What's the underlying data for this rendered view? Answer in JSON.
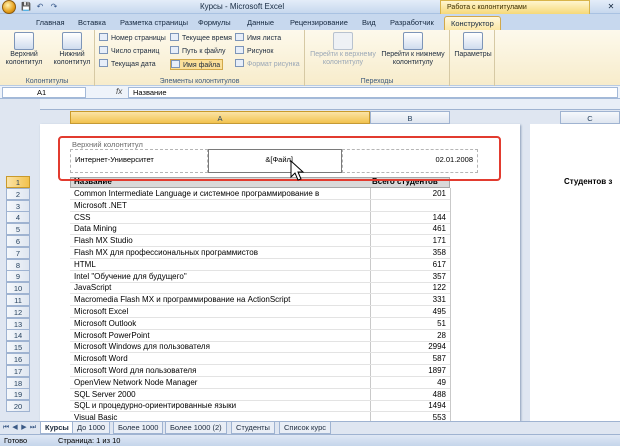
{
  "window": {
    "title": "Курсы - Microsoft Excel",
    "contextual": "Работа с колонтитулами"
  },
  "quick_access": {
    "save": "💾",
    "undo": "↶",
    "redo": "↷"
  },
  "window_controls": {
    "minimize": "–",
    "restore": "❐",
    "close": "✕"
  },
  "tabs": [
    "Главная",
    "Вставка",
    "Разметка страницы",
    "Формулы",
    "Данные",
    "Рецензирование",
    "Вид",
    "Разработчик",
    "Конструктор"
  ],
  "ribbon": {
    "groups": {
      "headers": "Колонтитулы",
      "elements": "Элементы колонтитулов",
      "nav": "Переходы",
      "params": ""
    },
    "buttons": {
      "header": "Верхний колонтитул",
      "footer": "Нижний колонтитул",
      "page_number": "Номер страницы",
      "page_count": "Число страниц",
      "current_date": "Текущая дата",
      "current_time": "Текущее время",
      "file_path": "Путь к файлу",
      "file_name": "Имя файла",
      "sheet_name": "Имя листа",
      "picture": "Рисунок",
      "format_picture": "Формат рисунка",
      "goto_header": "Перейти к верхнему колонтитулу",
      "goto_footer": "Перейти к нижнему колонтитулу",
      "params": "Параметры"
    }
  },
  "formula_bar": {
    "name_box": "A1",
    "fx": "fx",
    "value": "Название"
  },
  "columns": {
    "A": "A",
    "B": "B",
    "C": "C"
  },
  "header_zone": {
    "label": "Верхний колонтитул",
    "left": "Интернет-Университет",
    "center": "&[Файл]",
    "right": "02.01.2008"
  },
  "table": {
    "headers": [
      "Название",
      "Всего студентов"
    ],
    "page2_header": "Студентов з",
    "rows": [
      [
        "Common Intermediate Language и системное программирование в",
        "201"
      ],
      [
        "Microsoft .NET",
        ""
      ],
      [
        "CSS",
        "144"
      ],
      [
        "Data Mining",
        "461"
      ],
      [
        "Flash MX Studio",
        "171"
      ],
      [
        "Flash MX для профессиональных программистов",
        "358"
      ],
      [
        "HTML",
        "617"
      ],
      [
        "Intel \"Обучение для будущего\"",
        "357"
      ],
      [
        "JavaScript",
        "122"
      ],
      [
        "Macromedia Flash MX и программирование на ActionScript",
        "331"
      ],
      [
        "Microsoft Excel",
        "495"
      ],
      [
        "Microsoft Outlook",
        "51"
      ],
      [
        "Microsoft PowerPoint",
        "28"
      ],
      [
        "Microsoft Windows для пользователя",
        "2994"
      ],
      [
        "Microsoft Word",
        "587"
      ],
      [
        "Microsoft Word для пользователя",
        "1897"
      ],
      [
        "OpenView Network Node Manager",
        "49"
      ],
      [
        "SQL Server 2000",
        "488"
      ],
      [
        "SQL и процедурно-ориентированные языки",
        "1494"
      ],
      [
        "Visual Basic",
        "553"
      ]
    ],
    "row_numbers": [
      "1",
      "2",
      "3",
      "4",
      "5",
      "6",
      "7",
      "8",
      "9",
      "10",
      "11",
      "12",
      "13",
      "14",
      "15",
      "16",
      "17",
      "18",
      "19",
      "20"
    ]
  },
  "sheet_tabs": [
    "Курсы",
    "До 1000",
    "Более 1000",
    "Более 1000 (2)",
    "Студенты",
    "Список курс"
  ],
  "status": {
    "ready": "Готово",
    "page": "Страница: 1 из 10"
  }
}
